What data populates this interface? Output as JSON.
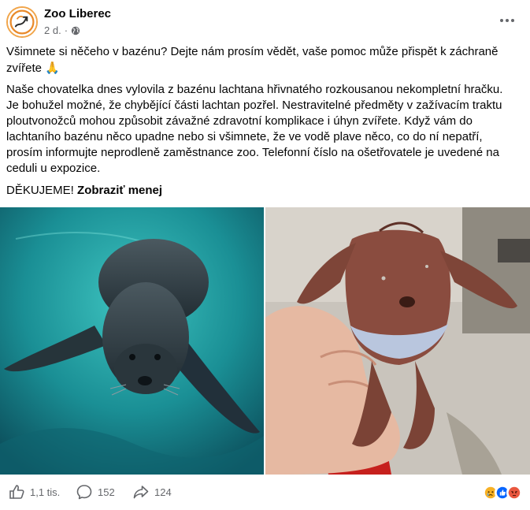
{
  "post": {
    "page_name": "Zoo Liberec",
    "time": "2 d.",
    "separator": "·",
    "intro": "Všimnete si něčeho v bazénu? Dejte nám prosím vědět, vaše pomoc může přispět k záchraně zvířete",
    "intro_emoji": "🙏",
    "body": "Naše chovatelka dnes vylovila z bazénu lachtana hřivnatého rozkousanou nekompletní hračku. Je bohužel možné, že chybějící části lachtan pozřel. Nestravitelné předměty v zažívacím traktu ploutvonožců mohou způsobit závažné zdravotní komplikace i úhyn zvířete. Když vám do lachtaního bazénu něco upadne nebo si všimnete, že ve vodě plave něco, co do ní nepatří, prosím informujte neprodleně zaměstnance zoo. Telefonní číslo na ošetřovatele je uvedené na ceduli u expozice.",
    "thanks": "DĚKUJEME!",
    "see_less": "Zobraziť menej"
  },
  "photos": [
    {
      "subject": "sea-lion-underwater"
    },
    {
      "subject": "chewed-toy-in-hand"
    }
  ],
  "footer": {
    "likes": "1,1 tis.",
    "comments": "152",
    "shares": "124"
  },
  "icons": {
    "more": "more-options-icon",
    "globe": "globe-icon",
    "like": "thumbs-up-icon",
    "comment": "comment-icon",
    "share": "share-icon"
  },
  "colors": {
    "text": "#050505",
    "secondary": "#65676b",
    "like_blue": "#0866ff",
    "angry": "#e9573f",
    "sad": "#f7b125"
  }
}
